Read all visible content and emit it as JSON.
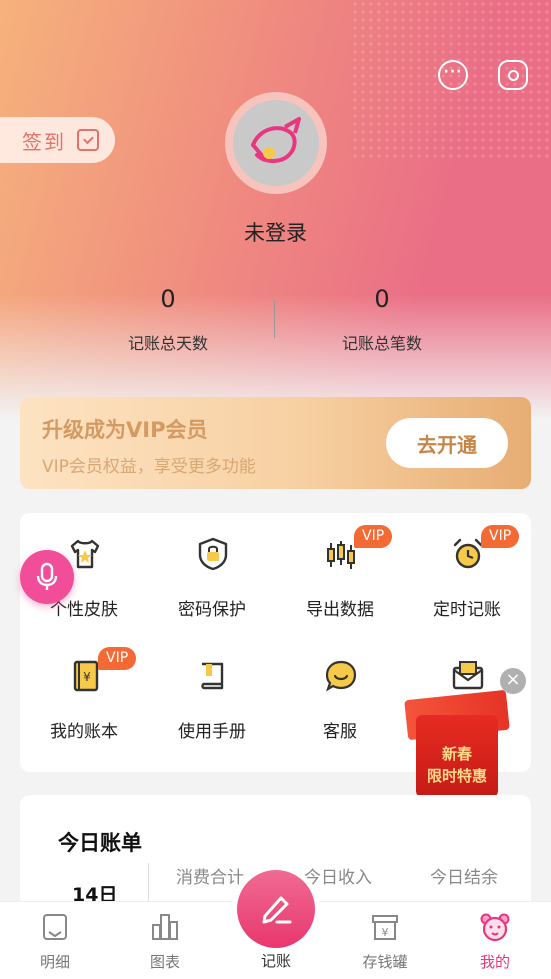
{
  "header": {
    "checkin_label": "签到",
    "username": "未登录",
    "stats": [
      {
        "value": "0",
        "label": "记账总天数"
      },
      {
        "value": "0",
        "label": "记账总笔数"
      }
    ]
  },
  "vip_banner": {
    "title": "升级成为VIP会员",
    "subtitle": "VIP会员权益，享受更多功能",
    "button": "去开通"
  },
  "features": [
    {
      "label": "个性皮肤",
      "icon": "shirt-icon",
      "vip": ""
    },
    {
      "label": "密码保护",
      "icon": "lock-icon",
      "vip": ""
    },
    {
      "label": "导出数据",
      "icon": "candlestick-icon",
      "vip": "VIP"
    },
    {
      "label": "定时记账",
      "icon": "alarm-clock-icon",
      "vip": "VIP"
    },
    {
      "label": "我的账本",
      "icon": "ledger-icon",
      "vip": "VIP"
    },
    {
      "label": "使用手册",
      "icon": "manual-icon",
      "vip": ""
    },
    {
      "label": "客服",
      "icon": "smile-chat-icon",
      "vip": ""
    },
    {
      "label": "",
      "icon": "envelope-icon",
      "vip": ""
    }
  ],
  "promo": {
    "line1": "新春",
    "line2": "限时特惠",
    "close": "×"
  },
  "today_bill": {
    "title": "今日账单",
    "date": "14日",
    "columns": [
      "消费合计",
      "今日收入",
      "今日结余"
    ]
  },
  "tabbar": {
    "tabs": [
      {
        "label": "明细",
        "icon": "detail-icon"
      },
      {
        "label": "图表",
        "icon": "chart-icon"
      },
      {
        "label": "记账",
        "icon": "pen-icon"
      },
      {
        "label": "存钱罐",
        "icon": "piggy-box-icon"
      },
      {
        "label": "我的",
        "icon": "bear-face-icon"
      }
    ],
    "active": "我的"
  },
  "colors": {
    "accent": "#e8367f",
    "vip_gold": "#d49a62",
    "badge": "#f46a35",
    "mic": "#f14d99"
  }
}
